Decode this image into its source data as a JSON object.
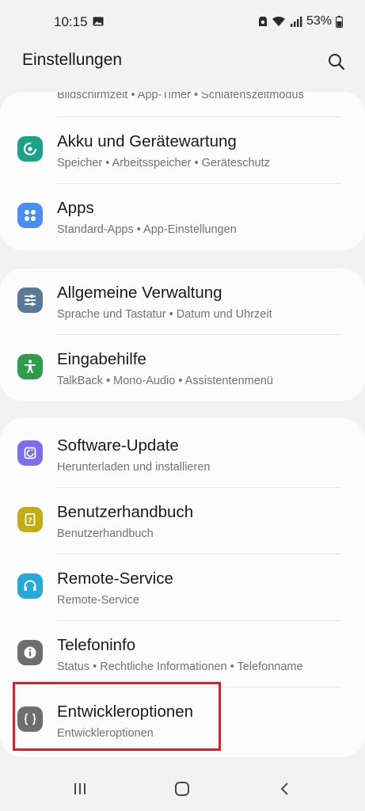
{
  "status_bar": {
    "time": "10:15",
    "battery_percent": "53%",
    "icons": [
      "gallery-icon",
      "notification-app-icon",
      "wifi-icon",
      "signal-icon",
      "battery-icon"
    ]
  },
  "header": {
    "title": "Einstellungen",
    "search_icon": "search-icon"
  },
  "cards": [
    {
      "rows": [
        {
          "title": "",
          "subtitle": "Bildschirmzeit • App-Timer • Schlafenszeitmodus",
          "partial": true
        },
        {
          "title": "Akku und Gerätewartung",
          "subtitle": "Speicher • Arbeitsspeicher • Geräteschutz",
          "icon": "device-care-icon",
          "icon_color": "#1aa389"
        },
        {
          "title": "Apps",
          "subtitle": "Standard-Apps • App-Einstellungen",
          "icon": "apps-icon",
          "icon_color": "#4c8ef0"
        }
      ]
    },
    {
      "rows": [
        {
          "title": "Allgemeine Verwaltung",
          "subtitle": "Sprache und Tastatur • Datum und Uhrzeit",
          "icon": "sliders-icon",
          "icon_color": "#5a7897"
        },
        {
          "title": "Eingabehilfe",
          "subtitle": "TalkBack • Mono-Audio • Assistentenmenü",
          "icon": "accessibility-icon",
          "icon_color": "#2e9c4c"
        }
      ]
    },
    {
      "rows": [
        {
          "title": "Software-Update",
          "subtitle": "Herunterladen und installieren",
          "icon": "software-update-icon",
          "icon_color": "#7a6df0"
        },
        {
          "title": "Benutzerhandbuch",
          "subtitle": "Benutzerhandbuch",
          "icon": "manual-icon",
          "icon_color": "#c4ad12"
        },
        {
          "title": "Remote-Service",
          "subtitle": "Remote-Service",
          "icon": "headset-icon",
          "icon_color": "#27a9d6"
        },
        {
          "title": "Telefoninfo",
          "subtitle": "Status • Rechtliche Informationen • Telefonname",
          "icon": "info-icon",
          "icon_color": "#6e6e6e"
        },
        {
          "title": "Entwickleroptionen",
          "subtitle": "Entwickleroptionen",
          "icon": "developer-braces-icon",
          "icon_color": "#6e6e6e",
          "highlighted": true
        }
      ]
    }
  ],
  "highlight_color": "#d9202b",
  "nav_bar": {
    "icons": [
      "recents-icon",
      "home-icon",
      "back-icon"
    ]
  }
}
